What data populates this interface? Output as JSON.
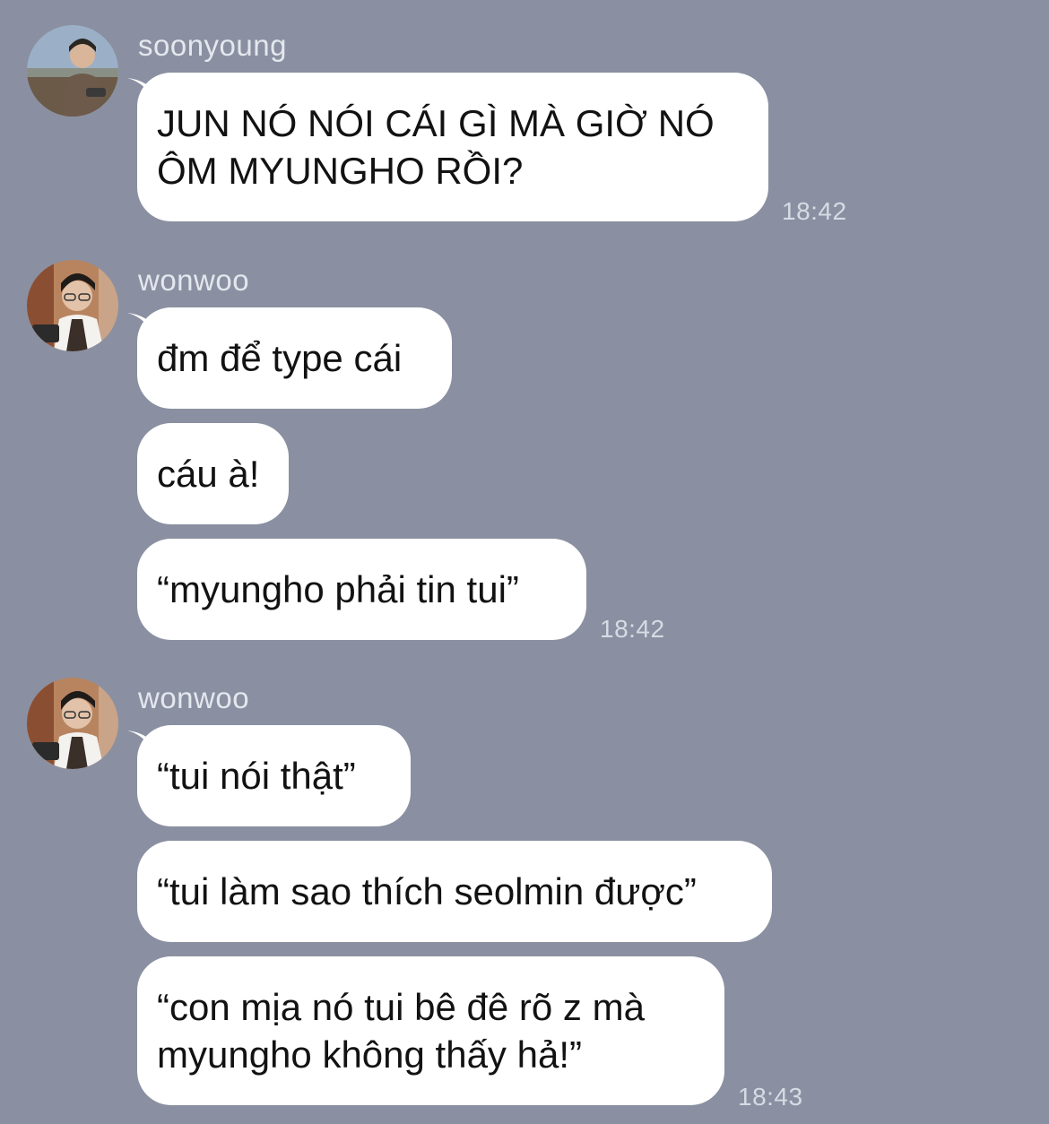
{
  "chat": {
    "groups": [
      {
        "sender": "soonyoung",
        "avatar_icon": "user-avatar-photo",
        "messages": [
          {
            "text": "JUN NÓ NÓI CÁI GÌ MÀ GIỜ NÓ ÔM MYUNGHO RỒI?"
          }
        ],
        "time": "18:42"
      },
      {
        "sender": "wonwoo",
        "avatar_icon": "user-avatar-photo",
        "messages": [
          {
            "text": "đm để type cái"
          },
          {
            "text": "cáu à!"
          },
          {
            "text": "“myungho phải tin tui”"
          }
        ],
        "time": "18:42"
      },
      {
        "sender": "wonwoo",
        "avatar_icon": "user-avatar-photo",
        "messages": [
          {
            "text": "“tui nói thật”"
          },
          {
            "text": "“tui làm sao thích seolmin được”"
          },
          {
            "text": "“con mịa nó tui bê đê rõ z mà myungho không thấy hả!”"
          }
        ],
        "time": "18:43"
      }
    ]
  },
  "colors": {
    "background": "#8a90a1",
    "bubble": "#ffffff",
    "text": "#121212",
    "meta_text": "#e4e7ee"
  }
}
